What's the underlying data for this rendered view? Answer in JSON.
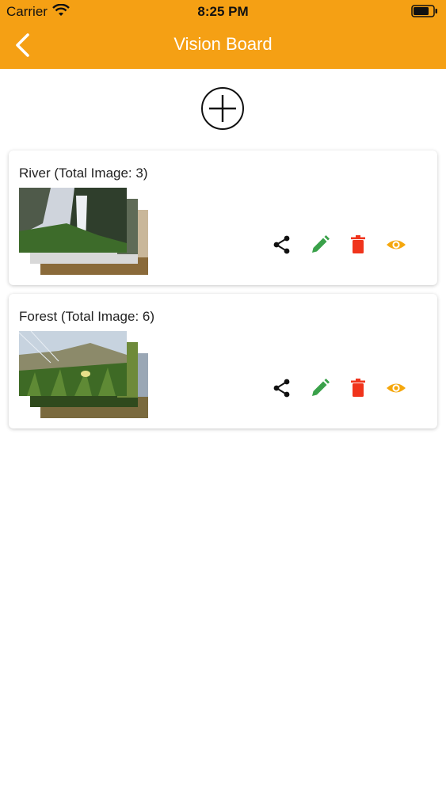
{
  "status_bar": {
    "carrier": "Carrier",
    "time": "8:25 PM"
  },
  "header": {
    "title": "Vision Board",
    "back_icon": "chevron-left-icon",
    "background": "#f5a014"
  },
  "add_button": {
    "icon": "plus-circle-icon"
  },
  "boards": [
    {
      "title": "River (Total Image: 3)"
    },
    {
      "title": "Forest (Total Image: 6)"
    }
  ],
  "actions": {
    "share_icon": "share-icon",
    "edit_icon": "pencil-icon",
    "delete_icon": "trash-icon",
    "view_icon": "eye-icon",
    "colors": {
      "share": "#111111",
      "edit": "#3aa14a",
      "delete": "#f0341c",
      "view": "#f5a70d"
    }
  }
}
